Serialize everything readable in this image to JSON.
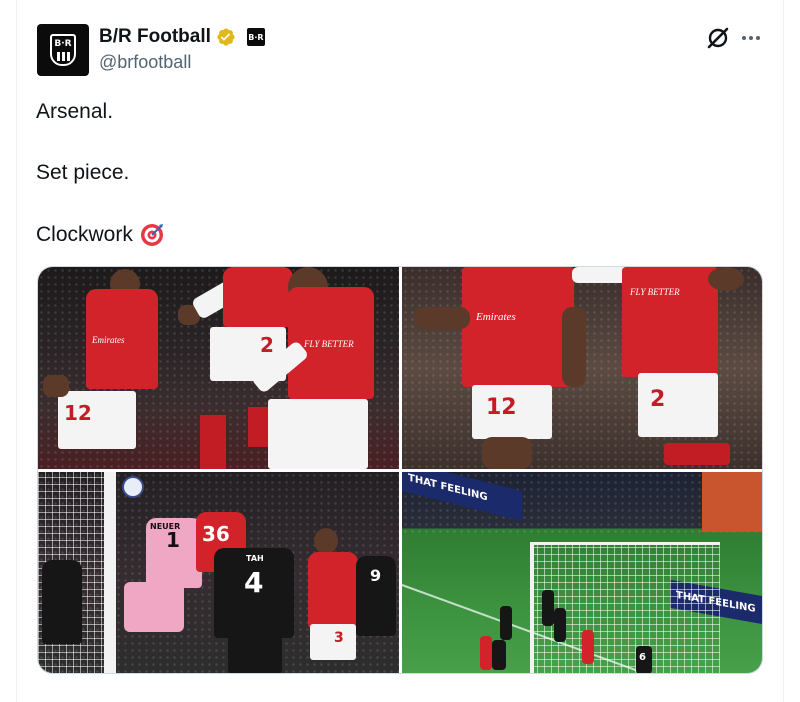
{
  "account": {
    "display_name": "B/R Football",
    "handle": "@brfootball",
    "avatar_text": "B·R",
    "badge_text": "B·R"
  },
  "tweet": {
    "lines": [
      "Arsenal.",
      "Set piece.",
      "Clockwork"
    ]
  },
  "media": {
    "photos": [
      {
        "numbers": [
          "12",
          "2"
        ],
        "sponsor": [
          "Emirates",
          "FLY BETTER"
        ]
      },
      {
        "numbers": [
          "12",
          "2"
        ],
        "sponsor": [
          "Emirates",
          "FLY BETTER"
        ]
      },
      {
        "numbers": [
          "1",
          "36",
          "4",
          "3",
          "9"
        ],
        "name_tags": [
          "NEUER",
          "TAH"
        ]
      },
      {
        "numbers": [
          "6"
        ],
        "boards": [
          "THAT FEELING",
          "THAT FEELING"
        ]
      }
    ]
  },
  "colors": {
    "text": "#0f1419",
    "secondary": "#536471",
    "verified_gold": "#e2b719",
    "arsenal_red": "#d3232a"
  },
  "icons": {
    "verified": "verified-badge-icon",
    "grok": "grok-icon",
    "more": "more-options-icon",
    "target": "direct-hit-icon"
  }
}
